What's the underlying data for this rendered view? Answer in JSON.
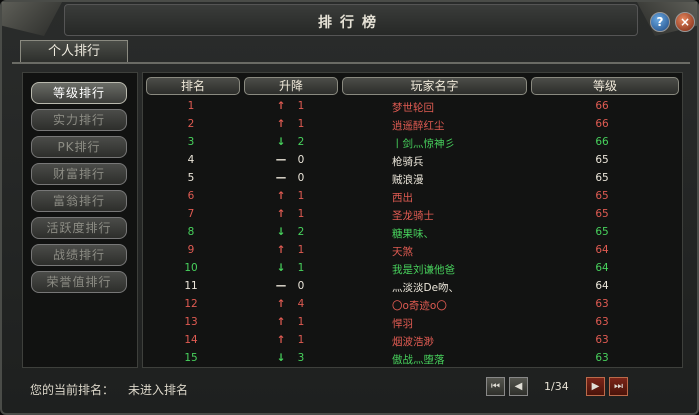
{
  "window": {
    "title": "排行榜"
  },
  "tabs": [
    {
      "label": "个人排行"
    }
  ],
  "sidebar": {
    "items": [
      {
        "label": "等级排行",
        "active": true
      },
      {
        "label": "实力排行",
        "active": false
      },
      {
        "label": "PK排行",
        "active": false
      },
      {
        "label": "财富排行",
        "active": false
      },
      {
        "label": "富翁排行",
        "active": false
      },
      {
        "label": "活跃度排行",
        "active": false
      },
      {
        "label": "战绩排行",
        "active": false
      },
      {
        "label": "荣誉值排行",
        "active": false
      }
    ]
  },
  "table": {
    "headers": [
      "排名",
      "升降",
      "玩家名字",
      "等级"
    ],
    "rows": [
      {
        "rank": "1",
        "arrow": "↑",
        "change": "1",
        "name": "梦世轮回",
        "level": "66",
        "color": "red"
      },
      {
        "rank": "2",
        "arrow": "↑",
        "change": "1",
        "name": "逍遥醉红尘",
        "level": "66",
        "color": "red"
      },
      {
        "rank": "3",
        "arrow": "↓",
        "change": "2",
        "name": "丨剑灬惊神彡",
        "level": "66",
        "color": "green"
      },
      {
        "rank": "4",
        "arrow": "—",
        "change": "0",
        "name": "枪骑兵",
        "level": "65",
        "color": "white"
      },
      {
        "rank": "5",
        "arrow": "—",
        "change": "0",
        "name": "贼浪漫",
        "level": "65",
        "color": "white"
      },
      {
        "rank": "6",
        "arrow": "↑",
        "change": "1",
        "name": "西出",
        "level": "65",
        "color": "red"
      },
      {
        "rank": "7",
        "arrow": "↑",
        "change": "1",
        "name": "圣龙骑士",
        "level": "65",
        "color": "red"
      },
      {
        "rank": "8",
        "arrow": "↓",
        "change": "2",
        "name": "糖果味、",
        "level": "65",
        "color": "green"
      },
      {
        "rank": "9",
        "arrow": "↑",
        "change": "1",
        "name": "天煞",
        "level": "64",
        "color": "red"
      },
      {
        "rank": "10",
        "arrow": "↓",
        "change": "1",
        "name": "我是刘谦他爸",
        "level": "64",
        "color": "green"
      },
      {
        "rank": "11",
        "arrow": "—",
        "change": "0",
        "name": "灬淡淡De吻、",
        "level": "64",
        "color": "white"
      },
      {
        "rank": "12",
        "arrow": "↑",
        "change": "4",
        "name": "〇o奇迹o〇",
        "level": "63",
        "color": "red"
      },
      {
        "rank": "13",
        "arrow": "↑",
        "change": "1",
        "name": "悍羽",
        "level": "63",
        "color": "red"
      },
      {
        "rank": "14",
        "arrow": "↑",
        "change": "1",
        "name": "烟波浩渺",
        "level": "63",
        "color": "red"
      },
      {
        "rank": "15",
        "arrow": "↓",
        "change": "3",
        "name": "傲战灬堕落",
        "level": "63",
        "color": "green"
      }
    ]
  },
  "footer": {
    "label": "您的当前排名：",
    "value": "未进入排名",
    "page": "1/34"
  },
  "colors": {
    "red": "#e05b52",
    "green": "#47d15c",
    "white": "#ece7db"
  },
  "icons": {
    "help": "help-icon",
    "close": "close-icon",
    "first": "first-page-icon",
    "prev": "prev-page-icon",
    "next": "next-page-icon",
    "last": "last-page-icon"
  }
}
